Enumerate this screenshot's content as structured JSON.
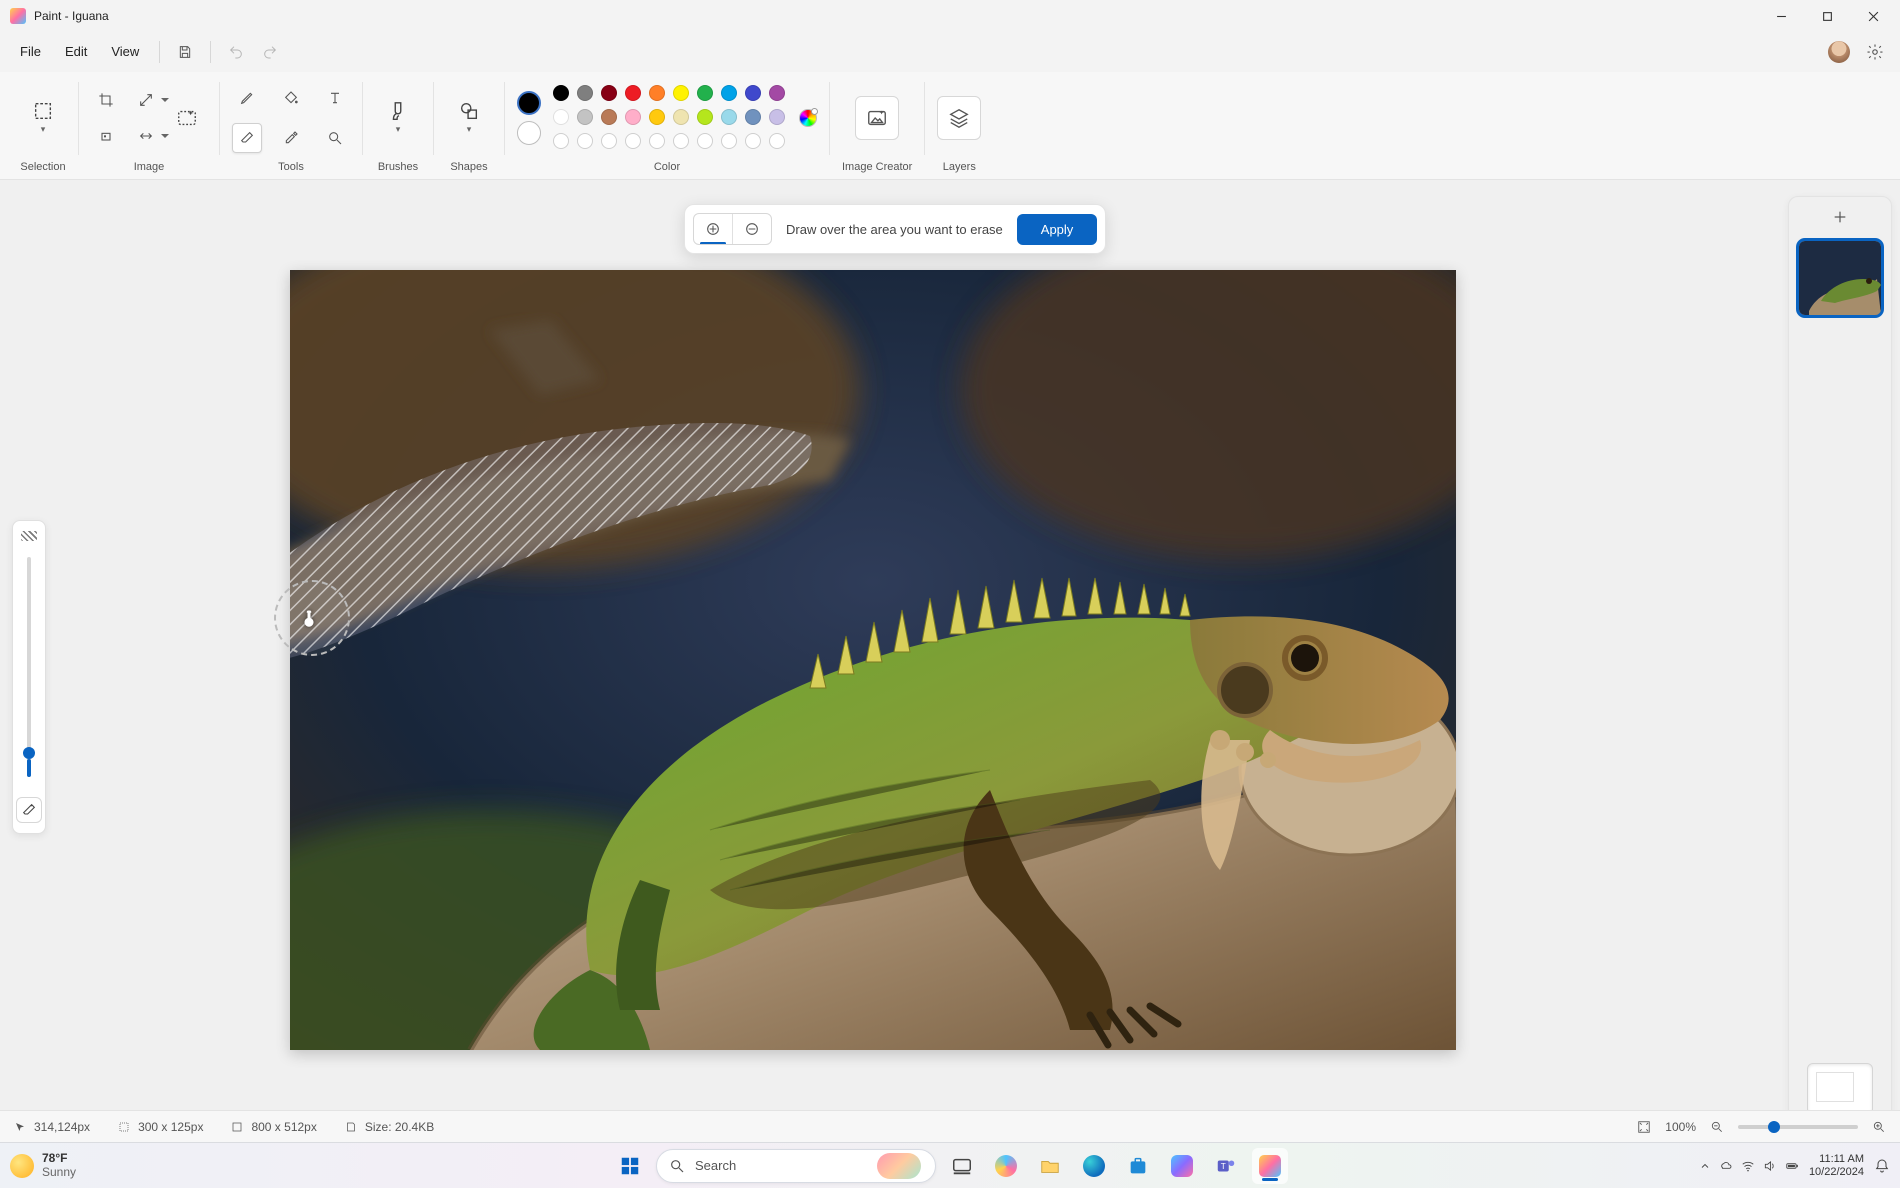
{
  "titlebar": {
    "title": "Paint - Iguana"
  },
  "menu": {
    "file": "File",
    "edit": "Edit",
    "view": "View"
  },
  "ribbon": {
    "selection": "Selection",
    "image": "Image",
    "tools": "Tools",
    "brushes": "Brushes",
    "shapes": "Shapes",
    "color": "Color",
    "image_creator": "Image Creator",
    "layers": "Layers"
  },
  "palette": {
    "primary": "#000000",
    "secondary": "#ffffff",
    "row1": [
      "#000000",
      "#7f7f7f",
      "#880015",
      "#ed1c24",
      "#ff7f27",
      "#fff200",
      "#22b14c",
      "#00a2e8",
      "#3f48cc",
      "#a349a4"
    ],
    "row2": [
      "#ffffff",
      "#c3c3c3",
      "#b97a57",
      "#ffaec9",
      "#ffc90e",
      "#efe4b0",
      "#b5e61d",
      "#99d9ea",
      "#7092be",
      "#c8bfe7"
    ]
  },
  "erasebar": {
    "hint": "Draw over the area you want to erase",
    "apply": "Apply"
  },
  "status": {
    "cursor": "314,124px",
    "selection": "300  x  125px",
    "canvas": "800  x  512px",
    "size": "Size: 20.4KB",
    "zoom": "100%"
  },
  "taskbar": {
    "temp": "78°F",
    "condition": "Sunny",
    "search": "Search",
    "time": "11:11 AM",
    "date": "10/22/2024"
  }
}
